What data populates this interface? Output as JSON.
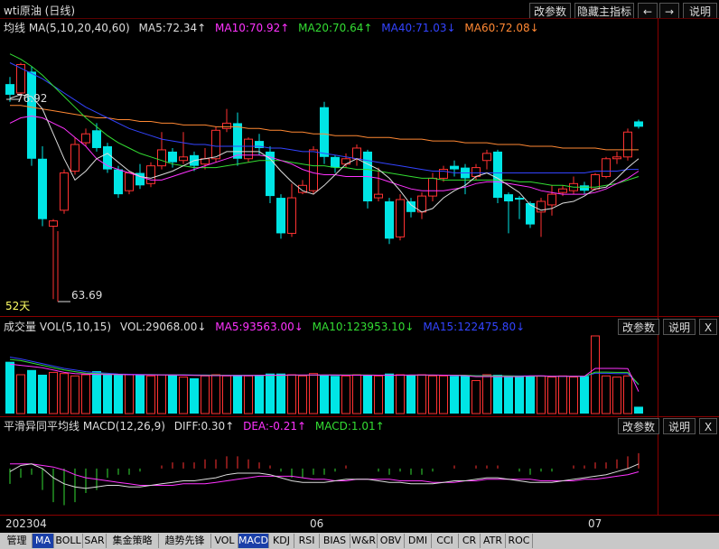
{
  "window": {
    "title": "wti原油 (日线)",
    "buttons": [
      "改参数",
      "隐藏主指标",
      "←",
      "→",
      "说明"
    ]
  },
  "main_panel": {
    "legend": [
      {
        "text": "均线 MA(5,10,20,40,60)",
        "color": "#dcdcdc"
      },
      {
        "text": "MA5:72.34↑",
        "color": "#dcdcdc"
      },
      {
        "text": "MA10:70.92↑",
        "color": "#ff33ff"
      },
      {
        "text": "MA20:70.64↑",
        "color": "#33dd33"
      },
      {
        "text": "MA40:71.03↓",
        "color": "#3344ff"
      },
      {
        "text": "MA60:72.08↓",
        "color": "#ff8833"
      }
    ],
    "high_label": "76.92",
    "low_label": "63.69",
    "days_label": "52天"
  },
  "volume_panel": {
    "legend": [
      {
        "text": "成交量 VOL(5,10,15)",
        "color": "#dcdcdc"
      },
      {
        "text": "VOL:29068.00↓",
        "color": "#dcdcdc"
      },
      {
        "text": "MA5:93563.00↓",
        "color": "#ff33ff"
      },
      {
        "text": "MA10:123953.10↓",
        "color": "#33dd33"
      },
      {
        "text": "MA15:122475.80↓",
        "color": "#3344ff"
      }
    ],
    "buttons": [
      "改参数",
      "说明",
      "X"
    ]
  },
  "macd_panel": {
    "legend": [
      {
        "text": "平滑异同平均线 MACD(12,26,9)",
        "color": "#dcdcdc"
      },
      {
        "text": "DIFF:0.30↑",
        "color": "#dcdcdc"
      },
      {
        "text": "DEA:-0.21↑",
        "color": "#ff33ff"
      },
      {
        "text": "MACD:1.01↑",
        "color": "#33dd33"
      }
    ],
    "buttons": [
      "改参数",
      "说明",
      "X"
    ]
  },
  "date_axis": {
    "labels": [
      "202304",
      "06",
      "07"
    ]
  },
  "tabs": [
    "管理",
    "MA",
    "BOLL",
    "SAR",
    "集金策略",
    "趋势先锋",
    "VOL",
    "MACD",
    "KDJ",
    "RSI",
    "BIAS",
    "W&R",
    "OBV",
    "DMI",
    "CCI",
    "CR",
    "ATR",
    "ROC"
  ],
  "active_tabs": [
    "MA",
    "MACD"
  ],
  "colors": {
    "up_candle": "#ff3232",
    "down_candle": "#00e5e5",
    "ma5": "#dcdcdc",
    "ma10": "#ff33ff",
    "ma20": "#33dd33",
    "ma40": "#3344ff",
    "ma60": "#ff8833",
    "macd_pos": "#ff3232",
    "macd_neg": "#33dd33",
    "grid": "#5a0000"
  },
  "chart_data": [
    {
      "type": "candlestick",
      "title": "wti原油 (日线)",
      "date_labels": [
        "202304",
        "06",
        "07"
      ],
      "ylim": [
        63.0,
        78.5
      ],
      "candles": [
        {
          "o": 75.8,
          "h": 76.2,
          "l": 74.8,
          "c": 75.2
        },
        {
          "o": 75.3,
          "h": 77.0,
          "l": 75.0,
          "c": 76.9
        },
        {
          "o": 76.5,
          "h": 76.8,
          "l": 71.2,
          "c": 71.6
        },
        {
          "o": 71.6,
          "h": 72.3,
          "l": 67.8,
          "c": 68.2
        },
        {
          "o": 67.8,
          "h": 68.2,
          "l": 63.7,
          "c": 68.1
        },
        {
          "o": 68.7,
          "h": 71.0,
          "l": 68.5,
          "c": 70.8
        },
        {
          "o": 70.9,
          "h": 72.8,
          "l": 70.7,
          "c": 72.4
        },
        {
          "o": 72.5,
          "h": 73.3,
          "l": 72.3,
          "c": 73.0
        },
        {
          "o": 73.2,
          "h": 73.6,
          "l": 72.0,
          "c": 72.2
        },
        {
          "o": 72.3,
          "h": 72.5,
          "l": 70.8,
          "c": 71.0
        },
        {
          "o": 71.0,
          "h": 71.2,
          "l": 69.4,
          "c": 69.6
        },
        {
          "o": 69.8,
          "h": 70.9,
          "l": 69.6,
          "c": 70.8
        },
        {
          "o": 70.8,
          "h": 71.3,
          "l": 69.9,
          "c": 70.1
        },
        {
          "o": 70.2,
          "h": 71.4,
          "l": 70.0,
          "c": 71.2
        },
        {
          "o": 71.2,
          "h": 73.1,
          "l": 71.0,
          "c": 72.1
        },
        {
          "o": 72.0,
          "h": 72.2,
          "l": 71.1,
          "c": 71.4
        },
        {
          "o": 71.5,
          "h": 73.1,
          "l": 71.3,
          "c": 71.7
        },
        {
          "o": 71.8,
          "h": 72.0,
          "l": 70.9,
          "c": 71.2
        },
        {
          "o": 71.3,
          "h": 72.2,
          "l": 71.0,
          "c": 71.6
        },
        {
          "o": 71.6,
          "h": 73.4,
          "l": 71.4,
          "c": 73.2
        },
        {
          "o": 73.3,
          "h": 74.4,
          "l": 73.1,
          "c": 73.6
        },
        {
          "o": 73.6,
          "h": 74.2,
          "l": 71.2,
          "c": 71.6
        },
        {
          "o": 71.6,
          "h": 72.8,
          "l": 71.4,
          "c": 72.7
        },
        {
          "o": 72.6,
          "h": 73.0,
          "l": 71.8,
          "c": 72.2
        },
        {
          "o": 72.0,
          "h": 72.3,
          "l": 69.1,
          "c": 69.5
        },
        {
          "o": 69.4,
          "h": 69.6,
          "l": 67.1,
          "c": 67.4
        },
        {
          "o": 67.4,
          "h": 70.2,
          "l": 67.2,
          "c": 69.4
        },
        {
          "o": 69.7,
          "h": 70.4,
          "l": 69.6,
          "c": 70.1
        },
        {
          "o": 69.8,
          "h": 72.3,
          "l": 69.6,
          "c": 72.1
        },
        {
          "o": 74.5,
          "h": 74.8,
          "l": 71.3,
          "c": 71.7
        },
        {
          "o": 71.7,
          "h": 71.8,
          "l": 70.8,
          "c": 71.1
        },
        {
          "o": 71.3,
          "h": 71.9,
          "l": 71.1,
          "c": 71.6
        },
        {
          "o": 71.6,
          "h": 72.4,
          "l": 71.2,
          "c": 72.2
        },
        {
          "o": 72.0,
          "h": 72.1,
          "l": 68.8,
          "c": 69.2
        },
        {
          "o": 69.4,
          "h": 71.1,
          "l": 69.2,
          "c": 69.6
        },
        {
          "o": 69.2,
          "h": 69.4,
          "l": 66.8,
          "c": 67.1
        },
        {
          "o": 67.2,
          "h": 69.6,
          "l": 67.0,
          "c": 69.3
        },
        {
          "o": 69.2,
          "h": 69.4,
          "l": 68.3,
          "c": 68.6
        },
        {
          "o": 68.6,
          "h": 69.7,
          "l": 68.2,
          "c": 69.5
        },
        {
          "o": 69.5,
          "h": 70.8,
          "l": 69.2,
          "c": 70.5
        },
        {
          "o": 70.5,
          "h": 71.2,
          "l": 70.3,
          "c": 71.0
        },
        {
          "o": 71.2,
          "h": 71.5,
          "l": 70.6,
          "c": 71.0
        },
        {
          "o": 71.1,
          "h": 71.3,
          "l": 69.6,
          "c": 70.5
        },
        {
          "o": 70.6,
          "h": 71.3,
          "l": 70.4,
          "c": 71.1
        },
        {
          "o": 71.5,
          "h": 72.1,
          "l": 71.0,
          "c": 71.9
        },
        {
          "o": 72.0,
          "h": 72.1,
          "l": 69.1,
          "c": 69.4
        },
        {
          "o": 69.6,
          "h": 69.7,
          "l": 67.4,
          "c": 69.2
        },
        {
          "o": 69.4,
          "h": 69.5,
          "l": 68.2,
          "c": 69.3
        },
        {
          "o": 69.1,
          "h": 69.2,
          "l": 67.7,
          "c": 67.9
        },
        {
          "o": 68.6,
          "h": 69.4,
          "l": 67.2,
          "c": 69.2
        },
        {
          "o": 69.0,
          "h": 70.1,
          "l": 68.4,
          "c": 69.6
        },
        {
          "o": 69.7,
          "h": 70.1,
          "l": 69.5,
          "c": 69.9
        },
        {
          "o": 69.8,
          "h": 70.6,
          "l": 69.6,
          "c": 70.2
        },
        {
          "o": 70.1,
          "h": 70.3,
          "l": 69.6,
          "c": 69.8
        },
        {
          "o": 69.9,
          "h": 70.8,
          "l": 69.8,
          "c": 70.7
        },
        {
          "o": 70.6,
          "h": 71.7,
          "l": 70.5,
          "c": 71.6
        },
        {
          "o": 71.6,
          "h": 72.0,
          "l": 71.3,
          "c": 71.7
        },
        {
          "o": 71.7,
          "h": 73.3,
          "l": 71.5,
          "c": 73.1
        },
        {
          "o": 73.7,
          "h": 73.8,
          "l": 73.3,
          "c": 73.4
        }
      ],
      "ma5": [
        75.0,
        75.2,
        75.1,
        74.4,
        73.0,
        71.6,
        70.4,
        70.9,
        71.6,
        71.9,
        71.4,
        70.9,
        70.6,
        70.5,
        70.7,
        70.9,
        71.2,
        71.5,
        71.6,
        71.7,
        72.0,
        72.0,
        72.0,
        72.0,
        71.6,
        70.9,
        70.3,
        69.8,
        69.6,
        70.1,
        70.7,
        71.3,
        71.6,
        71.3,
        71.0,
        70.5,
        69.8,
        69.0,
        68.6,
        68.8,
        69.4,
        69.8,
        70.1,
        70.6,
        70.8,
        70.5,
        70.1,
        69.7,
        69.0,
        68.7,
        68.8,
        69.1,
        69.2,
        69.5,
        69.9,
        70.0,
        70.5,
        71.1,
        71.6
      ],
      "ma10": [
        73.6,
        73.9,
        74.0,
        73.9,
        73.6,
        73.3,
        72.8,
        72.3,
        71.6,
        71.2,
        71.0,
        70.8,
        70.6,
        70.4,
        70.4,
        70.6,
        70.8,
        71.0,
        71.2,
        71.4,
        71.6,
        71.8,
        71.8,
        71.8,
        71.7,
        71.5,
        71.3,
        71.0,
        70.8,
        70.7,
        70.7,
        70.6,
        70.6,
        70.6,
        70.5,
        70.3,
        70.1,
        69.9,
        69.8,
        69.8,
        69.8,
        69.9,
        70.0,
        70.2,
        70.3,
        70.3,
        70.2,
        70.1,
        70.0,
        69.8,
        69.7,
        69.6,
        69.6,
        69.6,
        69.7,
        69.9,
        70.2,
        70.5,
        70.9
      ],
      "ma20": [
        77.5,
        77.2,
        76.8,
        76.3,
        75.7,
        75.1,
        74.5,
        73.9,
        73.4,
        72.9,
        72.5,
        72.2,
        71.9,
        71.7,
        71.5,
        71.3,
        71.2,
        71.1,
        71.1,
        71.1,
        71.2,
        71.3,
        71.4,
        71.5,
        71.5,
        71.5,
        71.4,
        71.3,
        71.2,
        71.2,
        71.1,
        71.1,
        71.0,
        71.0,
        70.9,
        70.8,
        70.7,
        70.6,
        70.5,
        70.5,
        70.4,
        70.4,
        70.4,
        70.4,
        70.4,
        70.4,
        70.4,
        70.3,
        70.3,
        70.2,
        70.1,
        70.1,
        70.0,
        70.0,
        70.0,
        70.1,
        70.2,
        70.4,
        70.6
      ],
      "ma40": [
        77.0,
        76.7,
        76.4,
        76.1,
        75.7,
        75.3,
        74.9,
        74.5,
        74.2,
        73.9,
        73.6,
        73.3,
        73.1,
        72.9,
        72.7,
        72.6,
        72.5,
        72.4,
        72.4,
        72.3,
        72.3,
        72.3,
        72.3,
        72.3,
        72.2,
        72.2,
        72.1,
        72.0,
        72.0,
        71.9,
        71.8,
        71.7,
        71.6,
        71.5,
        71.4,
        71.3,
        71.2,
        71.1,
        71.0,
        70.9,
        70.9,
        70.8,
        70.8,
        70.8,
        70.8,
        70.8,
        70.8,
        70.8,
        70.8,
        70.8,
        70.8,
        70.8,
        70.8,
        70.8,
        70.9,
        70.9,
        70.9,
        71.0,
        71.0
      ],
      "ma60": [
        74.6,
        74.6,
        74.5,
        74.4,
        74.3,
        74.2,
        74.1,
        74.0,
        73.9,
        73.9,
        73.8,
        73.8,
        73.7,
        73.7,
        73.6,
        73.6,
        73.5,
        73.5,
        73.5,
        73.4,
        73.4,
        73.4,
        73.3,
        73.3,
        73.2,
        73.2,
        73.1,
        73.1,
        73.0,
        73.0,
        72.9,
        72.9,
        72.9,
        72.8,
        72.8,
        72.8,
        72.7,
        72.7,
        72.7,
        72.6,
        72.6,
        72.6,
        72.5,
        72.5,
        72.5,
        72.4,
        72.4,
        72.4,
        72.3,
        72.3,
        72.3,
        72.2,
        72.2,
        72.2,
        72.2,
        72.1,
        72.1,
        72.1,
        72.1
      ]
    },
    {
      "type": "bar",
      "title": "成交量 VOL(5,10,15)",
      "ylim": [
        0,
        330000
      ],
      "volume": [
        220000,
        165000,
        185000,
        165000,
        175000,
        170000,
        160000,
        165000,
        180000,
        165000,
        165000,
        165000,
        165000,
        160000,
        165000,
        165000,
        155000,
        150000,
        160000,
        165000,
        160000,
        165000,
        160000,
        165000,
        170000,
        170000,
        165000,
        160000,
        170000,
        165000,
        160000,
        160000,
        165000,
        165000,
        160000,
        170000,
        165000,
        165000,
        165000,
        160000,
        160000,
        160000,
        160000,
        140000,
        165000,
        165000,
        160000,
        160000,
        160000,
        160000,
        155000,
        160000,
        155000,
        160000,
        330000,
        160000,
        155000,
        160000,
        29068
      ],
      "ma5": [
        210000,
        205000,
        200000,
        195000,
        185000,
        175000,
        170000,
        168000,
        166000,
        166000,
        166000,
        165000,
        165000,
        164000,
        164000,
        164000,
        163000,
        162000,
        161000,
        161000,
        161000,
        161000,
        161000,
        162000,
        163000,
        163000,
        164000,
        164000,
        164000,
        164000,
        164000,
        163000,
        163000,
        163000,
        163000,
        163000,
        163000,
        164000,
        164000,
        164000,
        163000,
        162000,
        161000,
        157000,
        157000,
        157000,
        157000,
        157000,
        160000,
        160000,
        158000,
        158000,
        158000,
        158000,
        192000,
        192000,
        192000,
        191000,
        93563
      ],
      "ma10": [
        230000,
        225000,
        215000,
        205000,
        195000,
        185000,
        178000,
        172000,
        170000,
        168000,
        166000,
        165000,
        165000,
        165000,
        164000,
        164000,
        164000,
        163000,
        163000,
        163000,
        162000,
        162000,
        162000,
        162000,
        162000,
        162000,
        163000,
        163000,
        163000,
        164000,
        164000,
        164000,
        164000,
        164000,
        163000,
        163000,
        163000,
        163000,
        163000,
        163000,
        163000,
        163000,
        163000,
        160000,
        160000,
        160000,
        160000,
        159000,
        159000,
        159000,
        158000,
        158000,
        158000,
        158000,
        176000,
        176000,
        175000,
        175000,
        123953
      ],
      "ma15": [
        240000,
        232000,
        222000,
        212000,
        202000,
        192000,
        185000,
        178000,
        174000,
        171000,
        168000,
        167000,
        166000,
        166000,
        165000,
        165000,
        165000,
        164000,
        164000,
        163000,
        163000,
        163000,
        163000,
        163000,
        163000,
        163000,
        163000,
        163000,
        163000,
        163000,
        163000,
        163000,
        163000,
        163000,
        163000,
        163000,
        163000,
        163000,
        163000,
        163000,
        163000,
        162000,
        162000,
        161000,
        161000,
        161000,
        160000,
        160000,
        160000,
        160000,
        159000,
        159000,
        159000,
        159000,
        171000,
        171000,
        170000,
        170000,
        122476
      ]
    },
    {
      "type": "bar",
      "title": "平滑异同平均线 MACD(12,26,9)",
      "ylim": [
        -2.9,
        2.3
      ],
      "diff": [
        -0.2,
        0.2,
        0.3,
        0.0,
        -0.6,
        -1.0,
        -1.2,
        -1.3,
        -1.2,
        -1.1,
        -1.1,
        -1.2,
        -1.2,
        -1.1,
        -1.0,
        -0.9,
        -0.8,
        -0.8,
        -0.7,
        -0.6,
        -0.4,
        -0.3,
        -0.3,
        -0.3,
        -0.4,
        -0.6,
        -0.8,
        -0.9,
        -0.9,
        -0.9,
        -0.8,
        -0.7,
        -0.7,
        -0.7,
        -0.8,
        -0.9,
        -0.9,
        -1.0,
        -1.0,
        -1.0,
        -0.9,
        -0.8,
        -0.8,
        -0.7,
        -0.6,
        -0.6,
        -0.7,
        -0.8,
        -0.9,
        -0.9,
        -0.9,
        -0.8,
        -0.7,
        -0.6,
        -0.5,
        -0.4,
        -0.2,
        0.0,
        0.3
      ],
      "dea": [
        0.3,
        0.3,
        0.3,
        0.2,
        0.1,
        -0.1,
        -0.4,
        -0.6,
        -0.7,
        -0.8,
        -0.9,
        -1.0,
        -1.1,
        -1.1,
        -1.1,
        -1.1,
        -1.0,
        -1.0,
        -1.0,
        -0.9,
        -0.8,
        -0.7,
        -0.6,
        -0.5,
        -0.5,
        -0.5,
        -0.5,
        -0.6,
        -0.7,
        -0.7,
        -0.8,
        -0.8,
        -0.7,
        -0.7,
        -0.7,
        -0.7,
        -0.8,
        -0.8,
        -0.8,
        -0.9,
        -0.9,
        -0.9,
        -0.8,
        -0.8,
        -0.7,
        -0.7,
        -0.7,
        -0.7,
        -0.7,
        -0.8,
        -0.8,
        -0.8,
        -0.8,
        -0.7,
        -0.7,
        -0.6,
        -0.5,
        -0.4,
        -0.21
      ],
      "macd": [
        -1.0,
        -0.6,
        -0.4,
        -1.4,
        -2.2,
        -2.4,
        -2.2,
        -1.6,
        -1.4,
        -0.6,
        -0.4,
        -0.4,
        -0.2,
        0.0,
        0.2,
        0.4,
        0.4,
        0.4,
        0.6,
        0.6,
        0.8,
        0.8,
        0.6,
        0.4,
        0.2,
        -0.2,
        -0.6,
        -0.6,
        -0.4,
        -0.4,
        -0.2,
        0.2,
        0.0,
        0.0,
        -0.2,
        -0.4,
        -0.2,
        -0.4,
        -0.4,
        -0.2,
        0.0,
        0.2,
        0.0,
        0.2,
        0.2,
        0.2,
        0.0,
        -0.2,
        -0.4,
        -0.2,
        -0.2,
        0.0,
        0.2,
        0.2,
        0.4,
        0.4,
        0.6,
        0.8,
        1.01
      ]
    }
  ]
}
